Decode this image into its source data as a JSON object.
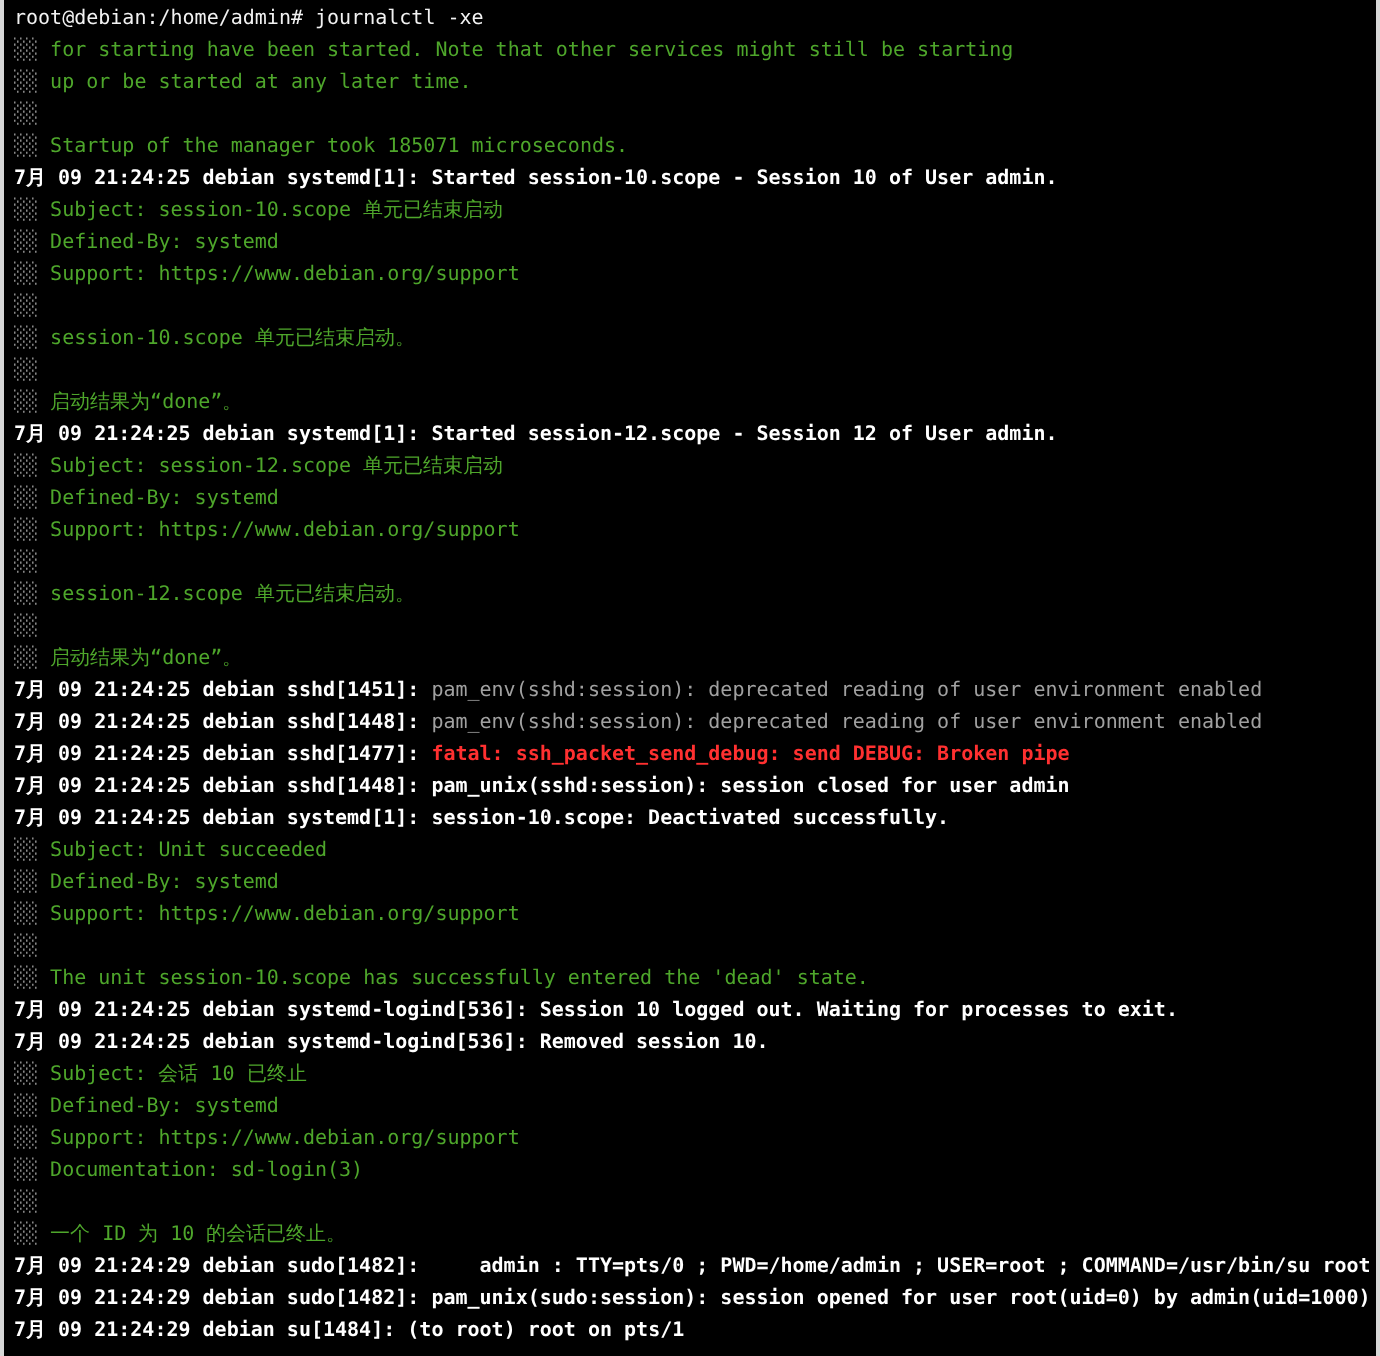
{
  "prompt": "root@debian:/home/admin# journalctl -xe",
  "lines": [
    {
      "kind": "catalog",
      "marker": "░░",
      "text": "for starting have been started. Note that other services might still be starting"
    },
    {
      "kind": "catalog",
      "marker": "░░",
      "text": "up or be started at any later time."
    },
    {
      "kind": "catalog",
      "marker": "░░"
    },
    {
      "kind": "catalog",
      "marker": "░░",
      "text": "Startup of the manager took 185071 microseconds."
    },
    {
      "kind": "entry",
      "prefix": "7月 09 21:24:25 debian systemd[1]:",
      "message": "Started session-10.scope - Session 10 of User admin."
    },
    {
      "kind": "catalog",
      "marker": "░░",
      "text": "Subject: session-10.scope 单元已结束启动"
    },
    {
      "kind": "catalog",
      "marker": "░░",
      "text": "Defined-By: systemd"
    },
    {
      "kind": "catalog",
      "marker": "░░",
      "text": "Support: https://www.debian.org/support"
    },
    {
      "kind": "catalog",
      "marker": "░░"
    },
    {
      "kind": "catalog",
      "marker": "░░",
      "text": "session-10.scope 单元已结束启动。"
    },
    {
      "kind": "catalog",
      "marker": "░░"
    },
    {
      "kind": "catalog",
      "marker": "░░",
      "text": "启动结果为“done”。"
    },
    {
      "kind": "entry",
      "prefix": "7月 09 21:24:25 debian systemd[1]:",
      "message": "Started session-12.scope - Session 12 of User admin."
    },
    {
      "kind": "catalog",
      "marker": "░░",
      "text": "Subject: session-12.scope 单元已结束启动"
    },
    {
      "kind": "catalog",
      "marker": "░░",
      "text": "Defined-By: systemd"
    },
    {
      "kind": "catalog",
      "marker": "░░",
      "text": "Support: https://www.debian.org/support"
    },
    {
      "kind": "catalog",
      "marker": "░░"
    },
    {
      "kind": "catalog",
      "marker": "░░",
      "text": "session-12.scope 单元已结束启动。"
    },
    {
      "kind": "catalog",
      "marker": "░░"
    },
    {
      "kind": "catalog",
      "marker": "░░",
      "text": "启动结果为“done”。"
    },
    {
      "kind": "debug",
      "prefix": "7月 09 21:24:25 debian sshd[1451]:",
      "message": "pam_env(sshd:session): deprecated reading of user environment enabled"
    },
    {
      "kind": "debug",
      "prefix": "7月 09 21:24:25 debian sshd[1448]:",
      "message": "pam_env(sshd:session): deprecated reading of user environment enabled"
    },
    {
      "kind": "error",
      "prefix": "7月 09 21:24:25 debian sshd[1477]:",
      "message": "fatal: ssh_packet_send_debug: send DEBUG: Broken pipe"
    },
    {
      "kind": "entry",
      "prefix": "7月 09 21:24:25 debian sshd[1448]:",
      "message": "pam_unix(sshd:session): session closed for user admin"
    },
    {
      "kind": "entry",
      "prefix": "7月 09 21:24:25 debian systemd[1]:",
      "message": "session-10.scope: Deactivated successfully."
    },
    {
      "kind": "catalog",
      "marker": "░░",
      "text": "Subject: Unit succeeded"
    },
    {
      "kind": "catalog",
      "marker": "░░",
      "text": "Defined-By: systemd"
    },
    {
      "kind": "catalog",
      "marker": "░░",
      "text": "Support: https://www.debian.org/support"
    },
    {
      "kind": "catalog",
      "marker": "░░"
    },
    {
      "kind": "catalog",
      "marker": "░░",
      "text": "The unit session-10.scope has successfully entered the 'dead' state."
    },
    {
      "kind": "entry",
      "prefix": "7月 09 21:24:25 debian systemd-logind[536]:",
      "message": "Session 10 logged out. Waiting for processes to exit."
    },
    {
      "kind": "entry",
      "prefix": "7月 09 21:24:25 debian systemd-logind[536]:",
      "message": "Removed session 10."
    },
    {
      "kind": "catalog",
      "marker": "░░",
      "text": "Subject: 会话 10 已终止"
    },
    {
      "kind": "catalog",
      "marker": "░░",
      "text": "Defined-By: systemd"
    },
    {
      "kind": "catalog",
      "marker": "░░",
      "text": "Support: https://www.debian.org/support"
    },
    {
      "kind": "catalog",
      "marker": "░░",
      "text": "Documentation: sd-login(3)"
    },
    {
      "kind": "catalog",
      "marker": "░░"
    },
    {
      "kind": "catalog",
      "marker": "░░",
      "text": "一个 ID 为 10 的会话已终止。"
    },
    {
      "kind": "entry",
      "prefix": "7月 09 21:24:29 debian sudo[1482]:",
      "message": "    admin : TTY=pts/0 ; PWD=/home/admin ; USER=root ; COMMAND=/usr/bin/su root"
    },
    {
      "kind": "entry",
      "prefix": "7月 09 21:24:29 debian sudo[1482]:",
      "message": "pam_unix(sudo:session): session opened for user root(uid=0) by admin(uid=1000)"
    },
    {
      "kind": "entry",
      "prefix": "7月 09 21:24:29 debian su[1484]:",
      "message": "(to root) root on pts/1"
    }
  ]
}
